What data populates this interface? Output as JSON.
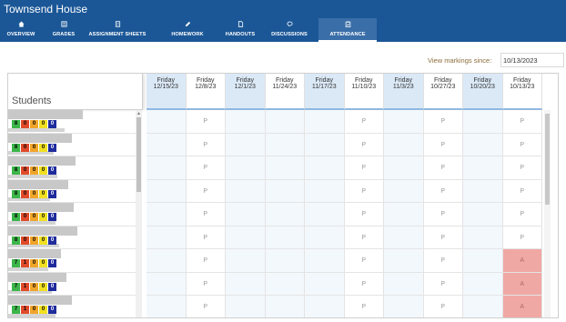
{
  "app": {
    "title": "Townsend House"
  },
  "tabs": [
    {
      "label": "OVERVIEW",
      "icon": "home-icon"
    },
    {
      "label": "GRADES",
      "icon": "grades-icon"
    },
    {
      "label": "ASSIGNMENT SHEETS",
      "icon": "document-icon"
    },
    {
      "label": "HOMEWORK",
      "icon": "pencil-icon"
    },
    {
      "label": "HANDOUTS",
      "icon": "file-icon"
    },
    {
      "label": "DISCUSSIONS",
      "icon": "chat-icon"
    },
    {
      "label": "ATTENDANCE",
      "icon": "clipboard-icon",
      "active": true
    }
  ],
  "markings": {
    "label": "View markings since:",
    "value": "10/13/2023"
  },
  "students_header": "Students",
  "dates": [
    {
      "day": "Friday",
      "date": "12/15/23"
    },
    {
      "day": "Friday",
      "date": "12/8/23"
    },
    {
      "day": "Friday",
      "date": "12/1/23"
    },
    {
      "day": "Friday",
      "date": "11/24/23"
    },
    {
      "day": "Friday",
      "date": "11/17/23"
    },
    {
      "day": "Friday",
      "date": "11/10/23"
    },
    {
      "day": "Friday",
      "date": "11/3/23"
    },
    {
      "day": "Friday",
      "date": "10/27/23"
    },
    {
      "day": "Friday",
      "date": "10/20/23"
    },
    {
      "day": "Friday",
      "date": "10/13/23"
    }
  ],
  "students": [
    {
      "badges": [
        "8",
        "0",
        "0",
        "0",
        "0"
      ],
      "marks": [
        "",
        "P",
        "",
        "",
        "",
        "P",
        "",
        "P",
        "",
        "P"
      ]
    },
    {
      "badges": [
        "8",
        "0",
        "0",
        "0",
        "0"
      ],
      "marks": [
        "",
        "P",
        "",
        "",
        "",
        "P",
        "",
        "P",
        "",
        "P"
      ]
    },
    {
      "badges": [
        "8",
        "0",
        "0",
        "0",
        "0"
      ],
      "marks": [
        "",
        "P",
        "",
        "",
        "",
        "P",
        "",
        "P",
        "",
        "P"
      ]
    },
    {
      "badges": [
        "8",
        "0",
        "0",
        "0",
        "0"
      ],
      "marks": [
        "",
        "P",
        "",
        "",
        "",
        "P",
        "",
        "P",
        "",
        "P"
      ]
    },
    {
      "badges": [
        "8",
        "0",
        "0",
        "0",
        "0"
      ],
      "marks": [
        "",
        "P",
        "",
        "",
        "",
        "P",
        "",
        "P",
        "",
        "P"
      ]
    },
    {
      "badges": [
        "8",
        "0",
        "0",
        "0",
        "0"
      ],
      "marks": [
        "",
        "P",
        "",
        "",
        "",
        "P",
        "",
        "P",
        "",
        "P"
      ]
    },
    {
      "badges": [
        "7",
        "1",
        "0",
        "0",
        "0"
      ],
      "marks": [
        "",
        "P",
        "",
        "",
        "",
        "P",
        "",
        "P",
        "",
        "A"
      ]
    },
    {
      "badges": [
        "7",
        "1",
        "0",
        "0",
        "0"
      ],
      "marks": [
        "",
        "P",
        "",
        "",
        "",
        "P",
        "",
        "P",
        "",
        "A"
      ]
    },
    {
      "badges": [
        "7",
        "1",
        "0",
        "0",
        "0"
      ],
      "marks": [
        "",
        "P",
        "",
        "",
        "",
        "P",
        "",
        "P",
        "",
        "A"
      ]
    }
  ],
  "colors": {
    "header_bg": "#1b5797",
    "present_green": "#3cb64a",
    "absent_red": "#e04a2a",
    "late_orange": "#f0a52a",
    "excused_yellow": "#f0e020",
    "other_navy": "#1f2c9c",
    "absent_cell": "#f0a8a4"
  }
}
